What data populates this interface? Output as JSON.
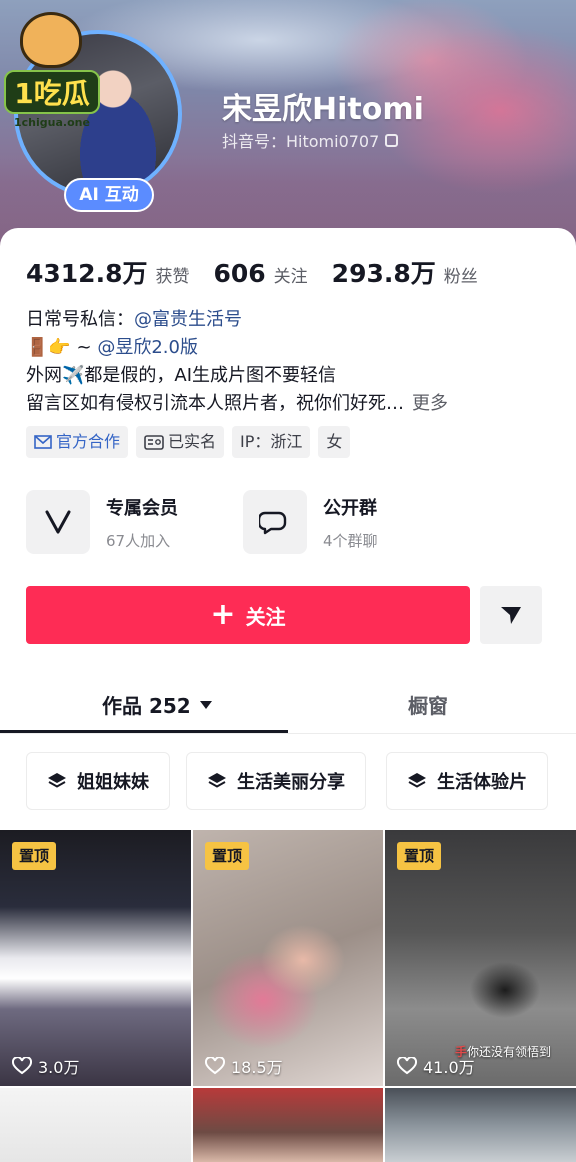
{
  "watermark": {
    "text": "1吃瓜",
    "url": "1chigua.one"
  },
  "profile": {
    "name": "宋昱欣Hitomi",
    "douyin_id": "抖音号：Hitomi0707",
    "ai_badge": "AI 互动"
  },
  "stats": [
    {
      "value": "4312.8万",
      "label": "获赞"
    },
    {
      "value": "606",
      "label": "关注"
    },
    {
      "value": "293.8万",
      "label": "粉丝"
    }
  ],
  "bio": {
    "line1_prefix": "日常号私信：",
    "line1_mention": "@富贵生活号",
    "line2_prefix": "🚪👉 ~ ",
    "line2_mention": "@昱欣2.0版",
    "line3": "外网✈️都是假的，AI生成片图不要轻信",
    "line4": "留言区如有侵权引流本人照片者，祝你们好死…",
    "more": "更多"
  },
  "tags": {
    "official": "官方合作",
    "verified": "已实名",
    "ip": "IP：浙江",
    "gender": "女"
  },
  "features": [
    {
      "title": "专属会员",
      "subtitle": "67人加入",
      "icon": "v-logo-icon"
    },
    {
      "title": "公开群",
      "subtitle": "4个群聊",
      "icon": "chat-bubble-icon"
    }
  ],
  "actions": {
    "follow": "关注",
    "message_icon": "send-icon"
  },
  "tabs": {
    "works": "作品 252",
    "shop": "橱窗"
  },
  "collections": [
    "姐姐妹妹",
    "生活美丽分享",
    "生活体验片"
  ],
  "videos": [
    {
      "pinned": "置顶",
      "likes": "3.0万"
    },
    {
      "pinned": "置顶",
      "likes": "18.5万"
    },
    {
      "pinned": "置顶",
      "likes": "41.0万",
      "caption_prefix": "你还没有",
      "caption_red": "手",
      "caption_suffix": "领悟到"
    }
  ],
  "colors": {
    "accent": "#fe2c55",
    "pin": "#f6c343",
    "mention": "#2c4d8c",
    "ai_badge": "#5b8cff"
  }
}
